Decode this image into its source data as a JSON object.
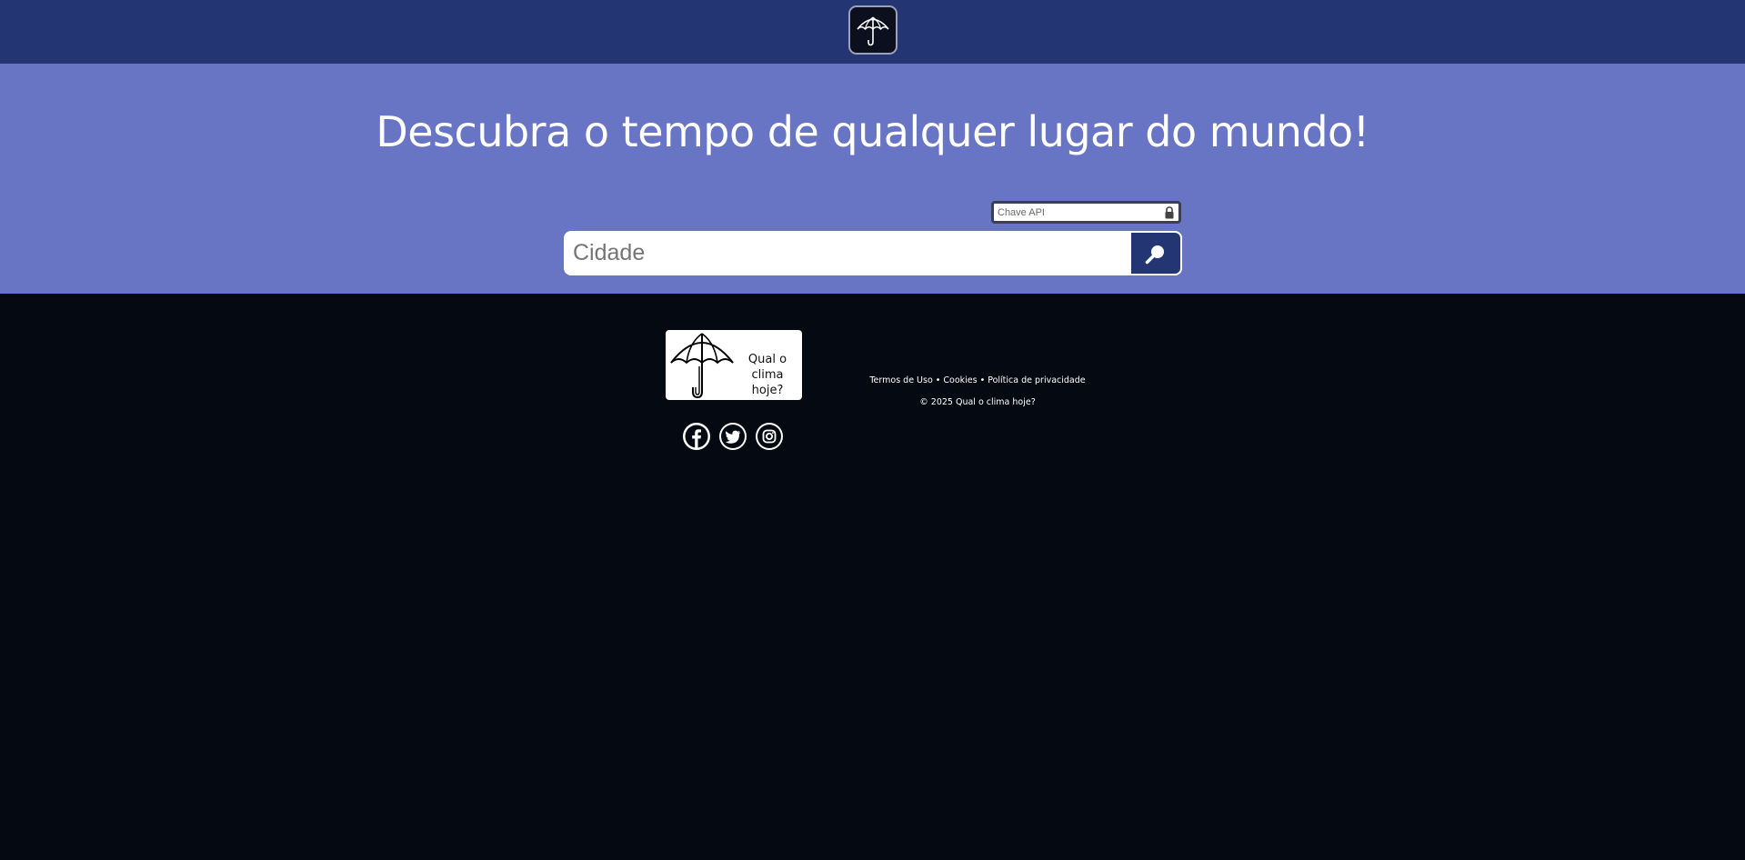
{
  "header": {
    "logo_icon": "umbrella-icon"
  },
  "hero": {
    "title": "Descubra o tempo de qualquer lugar do mundo!",
    "api_key_placeholder": "Chave API",
    "api_key_icon": "lock-icon",
    "city_placeholder": "Cidade",
    "search_icon": "search-icon"
  },
  "footer": {
    "logo_text_line1": "Qual o",
    "logo_text_line2": "clima hoje?",
    "socials": [
      {
        "name": "facebook",
        "icon": "facebook-icon"
      },
      {
        "name": "twitter",
        "icon": "twitter-icon"
      },
      {
        "name": "instagram",
        "icon": "instagram-icon"
      }
    ],
    "links": [
      {
        "label": "Termos de Uso"
      },
      {
        "label": "Cookies"
      },
      {
        "label": "Política de privacidade"
      }
    ],
    "separator": "•",
    "copyright": "© 2025 Qual o clima hoje?"
  },
  "colors": {
    "header_bg": "#243573",
    "hero_bg": "#6874c4",
    "page_bg": "#050912",
    "accent": "#243573"
  }
}
